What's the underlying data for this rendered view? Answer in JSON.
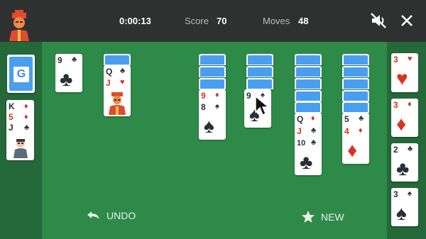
{
  "header": {
    "time": "0:00:13",
    "score_label": "Score",
    "score_value": "70",
    "moves_label": "Moves",
    "moves_value": "48",
    "mute_icon": "mute-icon",
    "close_icon": "close-icon"
  },
  "stock": {
    "logo": "G"
  },
  "waste": {
    "ranks": [
      "K",
      "5",
      "J"
    ]
  },
  "tableau": {
    "col1": {
      "rank": "9"
    },
    "col2": {
      "ranks": [
        "Q",
        "J"
      ]
    },
    "col3": {
      "ranks": [
        "9",
        "8"
      ]
    },
    "col4": {
      "ranks": [
        "9"
      ]
    },
    "col5": {
      "ranks": [
        "Q",
        "J",
        "10"
      ]
    },
    "col6": {
      "ranks": [
        "5",
        "4"
      ]
    }
  },
  "foundations": {
    "ranks": [
      "3",
      "3",
      "2",
      "3"
    ]
  },
  "footer": {
    "undo_label": "UNDO",
    "new_label": "NEW"
  },
  "colors": {
    "red": "#d8331f",
    "black": "#27303a",
    "felt": "#2e8a48",
    "back": "#4a9ef0"
  }
}
